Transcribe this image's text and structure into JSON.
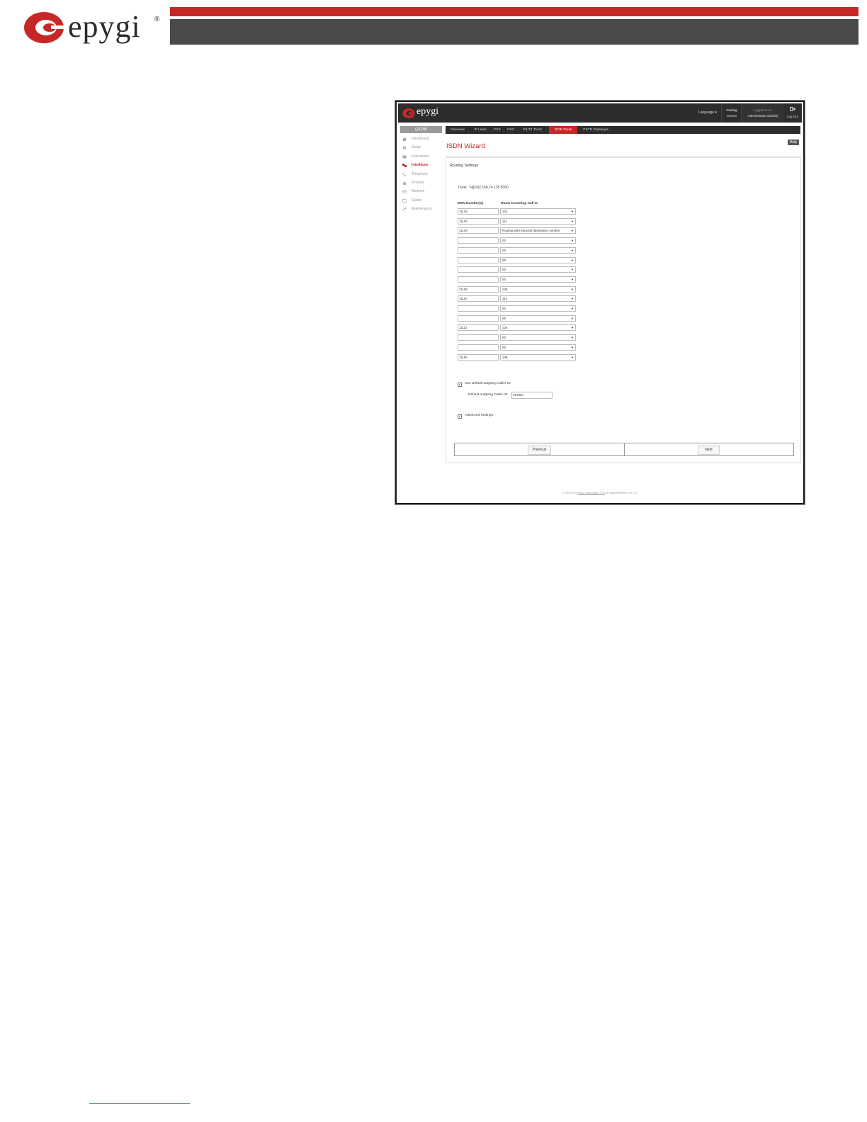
{
  "doc": {
    "logo_text": "epygi",
    "logo_mark": "®",
    "brand_colors": {
      "red": "#c62828",
      "dark": "#4a4a4a"
    }
  },
  "app": {
    "logo_text": "epygi",
    "header": {
      "language": "Language",
      "parking_title": "Parking",
      "parking_sub": "Guests",
      "logged_in_as": "Logged in As:",
      "user": "Administrator (admin)",
      "logout": "Log Out"
    },
    "model": "QX200",
    "sidebar": [
      {
        "label": "Dashboard",
        "icon": "dashboard-icon"
      },
      {
        "label": "Setup",
        "icon": "gear-icon"
      },
      {
        "label": "Extensions",
        "icon": "extensions-icon"
      },
      {
        "label": "Interfaces",
        "icon": "interfaces-icon",
        "active": true
      },
      {
        "label": "Telephony",
        "icon": "phone-icon"
      },
      {
        "label": "Firewall",
        "icon": "fire-icon"
      },
      {
        "label": "Network",
        "icon": "globe-icon"
      },
      {
        "label": "Status",
        "icon": "status-icon"
      },
      {
        "label": "Maintenance",
        "icon": "wrench-icon"
      }
    ],
    "tabs": [
      {
        "label": "Overview"
      },
      {
        "label": "IP Lines"
      },
      {
        "label": "FXS"
      },
      {
        "label": "FXO"
      },
      {
        "label": "E1/T1 Trunk"
      },
      {
        "label": "ISDN Trunk",
        "active": true
      },
      {
        "label": "PSTN Gateways"
      }
    ],
    "wizard_title": "ISDN Wizard",
    "help": "Help",
    "panel_title": "Routing Settings",
    "trunk": "Trunk :  h@192.168.74.135:5060",
    "col_msn": "MSN Number(s)",
    "col_route": "Route Incoming Call to",
    "rows": [
      {
        "msn": "11102",
        "route": "121"
      },
      {
        "msn": "11103",
        "route": "111"
      },
      {
        "msn": "11104",
        "route": "Routing with inbound destination number"
      },
      {
        "msn": "",
        "route": "00"
      },
      {
        "msn": "",
        "route": "00"
      },
      {
        "msn": "",
        "route": "00"
      },
      {
        "msn": "",
        "route": "00"
      },
      {
        "msn": "",
        "route": "00"
      },
      {
        "msn": "11108",
        "route": "136"
      },
      {
        "msn": "11110",
        "route": "113"
      },
      {
        "msn": "",
        "route": "00"
      },
      {
        "msn": "",
        "route": "00"
      },
      {
        "msn": "11112",
        "route": "134"
      },
      {
        "msn": "",
        "route": "00"
      },
      {
        "msn": "",
        "route": "00"
      },
      {
        "msn": "11115",
        "route": "135"
      }
    ],
    "use_default_caller_id": "Use Default outgoing Caller ID",
    "default_caller_id_label": "Default outgoing Caller ID:",
    "default_caller_id_value": "267894",
    "advanced_settings": "Advanced Settings",
    "previous": "Previous",
    "next": "Next",
    "footer_pre": "© 2000-2014",
    "footer_link": "Epygi Technologies, LTD",
    "footer_post": "All Rights Reserved. rev_471"
  }
}
